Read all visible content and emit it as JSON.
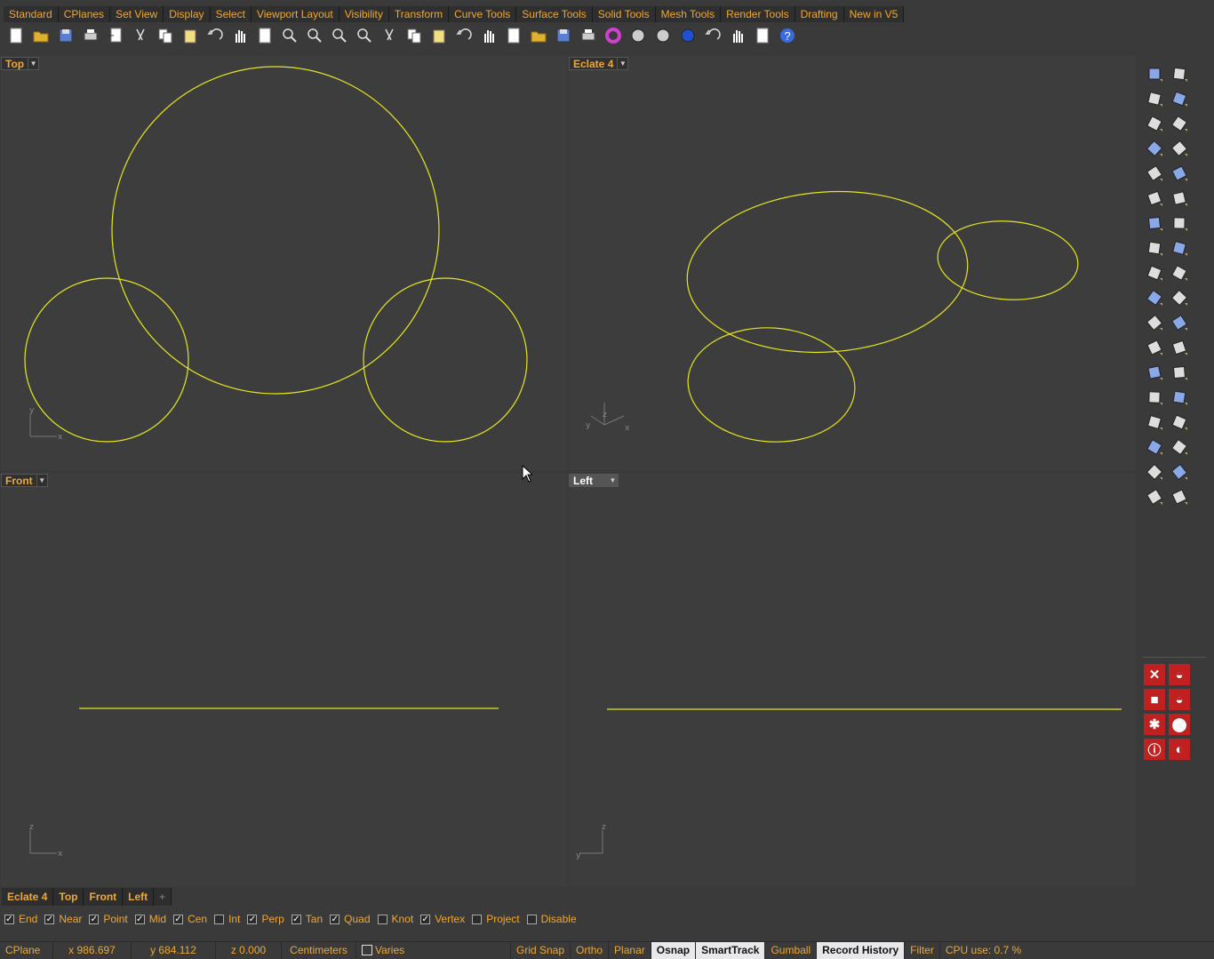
{
  "menu_tabs": [
    "Standard",
    "CPlanes",
    "Set View",
    "Display",
    "Select",
    "Viewport Layout",
    "Visibility",
    "Transform",
    "Curve Tools",
    "Surface Tools",
    "Solid Tools",
    "Mesh Tools",
    "Render Tools",
    "Drafting",
    "New in V5"
  ],
  "toolbar_icons": [
    "new-file-icon",
    "open-folder-icon",
    "save-icon",
    "print-icon",
    "import-icon",
    "cut-icon",
    "copy-icon",
    "paste-icon",
    "undo-icon",
    "pan-hand-icon",
    "rotate-view-icon",
    "zoom-icon",
    "zoom-window-icon",
    "zoom-extents-icon",
    "zoom-selected-icon",
    "rotate-camera-icon",
    "four-viewports-icon",
    "car-icon",
    "point-icon",
    "circle-icon",
    "snap-points-icon",
    "lightbulb-icon",
    "lock-icon",
    "layer-icon",
    "color-wheel-icon",
    "shaded-sphere-icon",
    "rendered-sphere-icon",
    "blue-sphere-icon",
    "material-icon",
    "settings-gear-icon",
    "grid-select-icon",
    "help-icon"
  ],
  "viewports": {
    "top": {
      "title": "Top",
      "axis_x": "x",
      "axis_y": "y"
    },
    "eclate": {
      "title": "Eclate 4",
      "axis_x": "x",
      "axis_y": "y",
      "axis_z": "z"
    },
    "front": {
      "title": "Front",
      "axis_x": "x",
      "axis_z": "z"
    },
    "left": {
      "title": "Left",
      "axis_y": "y",
      "axis_z": "z"
    }
  },
  "viewport_tabs": [
    "Eclate 4",
    "Top",
    "Front",
    "Left"
  ],
  "add_tab_symbol": "+",
  "osnaps": [
    {
      "label": "End",
      "checked": true
    },
    {
      "label": "Near",
      "checked": true
    },
    {
      "label": "Point",
      "checked": true
    },
    {
      "label": "Mid",
      "checked": true
    },
    {
      "label": "Cen",
      "checked": true
    },
    {
      "label": "Int",
      "checked": false
    },
    {
      "label": "Perp",
      "checked": true
    },
    {
      "label": "Tan",
      "checked": true
    },
    {
      "label": "Quad",
      "checked": true
    },
    {
      "label": "Knot",
      "checked": false
    },
    {
      "label": "Vertex",
      "checked": true
    },
    {
      "label": "Project",
      "checked": false
    },
    {
      "label": "Disable",
      "checked": false
    }
  ],
  "status": {
    "cplane": "CPlane",
    "x": "x 986.697",
    "y": "y 684.112",
    "z": "z 0.000",
    "units": "Centimeters",
    "layer": "Varies",
    "toggles": [
      {
        "label": "Grid Snap",
        "active": false
      },
      {
        "label": "Ortho",
        "active": false
      },
      {
        "label": "Planar",
        "active": false
      },
      {
        "label": "Osnap",
        "active": true
      },
      {
        "label": "SmartTrack",
        "active": true
      },
      {
        "label": "Gumball",
        "active": false
      },
      {
        "label": "Record History",
        "active": true
      },
      {
        "label": "Filter",
        "active": false
      }
    ],
    "cpu": "CPU use: 0.7 %"
  },
  "colors": {
    "curve": "#e6e61e",
    "accent": "#f0a830",
    "panel": "#3a3a3a",
    "viewport": "#3d3d3d",
    "red_button": "#c02020"
  }
}
